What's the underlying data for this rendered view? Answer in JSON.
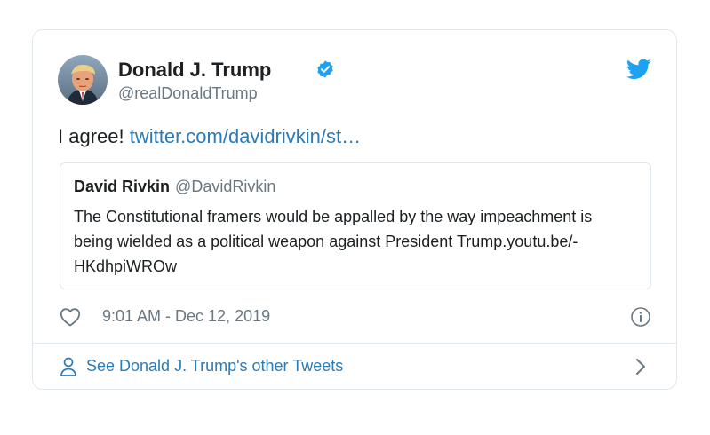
{
  "author": {
    "name": "Donald J. Trump",
    "handle": "@realDonaldTrump",
    "verified": true
  },
  "tweet": {
    "text": "I agree! ",
    "link": "twitter.com/davidrivkin/st…"
  },
  "quote": {
    "name": "David Rivkin",
    "handle": "@DavidRivkin",
    "body": "The Constitutional framers would be appalled by the way impeachment is being wielded as a political weapon against President Trump.youtu.be/-HKdhpiWROw"
  },
  "meta": {
    "timestamp": "9:01 AM - Dec 12, 2019"
  },
  "footer": {
    "link_label": "See Donald J. Trump's other Tweets"
  },
  "icons": {
    "brand": "twitter-bird-icon",
    "verified": "verified-badge-icon",
    "like": "heart-icon",
    "info": "info-icon",
    "profile": "person-icon",
    "more": "chevron-right-icon"
  },
  "colors": {
    "brand": "#1da1f2",
    "link": "#2b7bb9",
    "text": "#1c2022",
    "muted": "#697882",
    "border": "#e1e8ed"
  }
}
